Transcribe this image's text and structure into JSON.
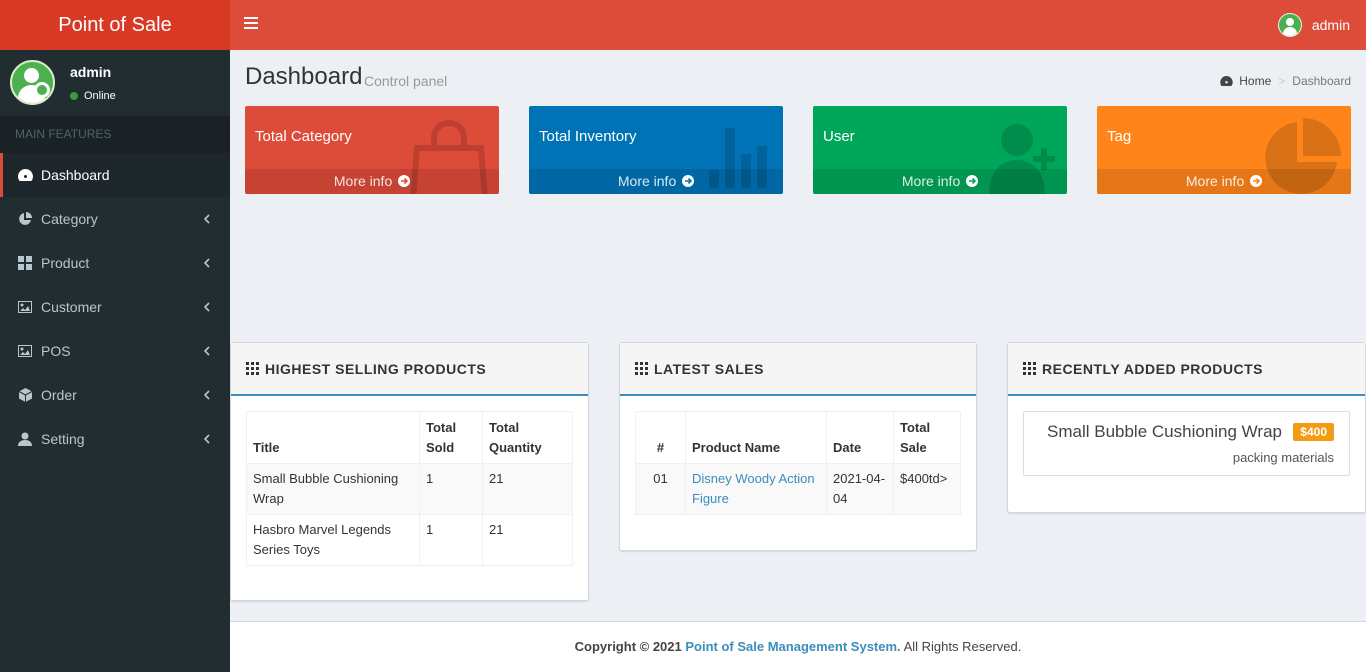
{
  "app": {
    "title": "Point of Sale"
  },
  "header": {
    "user_name": "admin"
  },
  "sidebar": {
    "user_name": "admin",
    "user_status": "Online",
    "menu_header": "MAIN FEATURES",
    "items": [
      {
        "label": "Dashboard",
        "icon": "dashboard-icon",
        "active": true
      },
      {
        "label": "Category",
        "icon": "pie-chart-icon"
      },
      {
        "label": "Product",
        "icon": "grid-icon"
      },
      {
        "label": "Customer",
        "icon": "image-icon"
      },
      {
        "label": "POS",
        "icon": "image-icon"
      },
      {
        "label": "Order",
        "icon": "cube-icon"
      },
      {
        "label": "Setting",
        "icon": "user-icon"
      }
    ]
  },
  "page": {
    "title": "Dashboard",
    "subtitle": "Control panel",
    "breadcrumb": {
      "home": "Home",
      "current": "Dashboard"
    }
  },
  "stat_boxes": [
    {
      "title": "Total Category",
      "footer": "More info",
      "color": "#dd4b39",
      "icon": "shopping-bag-icon"
    },
    {
      "title": "Total Inventory",
      "footer": "More info",
      "color": "#0073b7",
      "icon": "bar-chart-icon"
    },
    {
      "title": "User",
      "footer": "More info",
      "color": "#00a65a",
      "icon": "user-plus-icon"
    },
    {
      "title": "Tag",
      "footer": "More info",
      "color": "#ff851b",
      "icon": "pie-chart-icon"
    }
  ],
  "highest_selling": {
    "title": "HIGHEST SELLING PRODUCTS",
    "headers": {
      "title": "Title",
      "sold": "Total Sold",
      "qty": "Total Quantity"
    },
    "rows": [
      {
        "title": "Small Bubble Cushioning Wrap",
        "sold": "1",
        "qty": "21"
      },
      {
        "title": "Hasbro Marvel Legends Series Toys",
        "sold": "1",
        "qty": "21"
      }
    ]
  },
  "latest_sales": {
    "title": "LATEST SALES",
    "headers": {
      "num": "#",
      "name": "Product Name",
      "date": "Date",
      "total": "Total Sale"
    },
    "rows": [
      {
        "num": "01",
        "name": "Disney Woody Action Figure",
        "date": "2021-04-04",
        "total": "$400td>"
      }
    ]
  },
  "recent_products": {
    "title": "RECENTLY ADDED PRODUCTS",
    "items": [
      {
        "name": "Small Bubble Cushioning Wrap",
        "price": "$400",
        "category": "packing materials"
      }
    ]
  },
  "footer": {
    "copyright": "Copyright © 2021",
    "brand": "Point of Sale Management System.",
    "rights": "All Rights Reserved."
  }
}
